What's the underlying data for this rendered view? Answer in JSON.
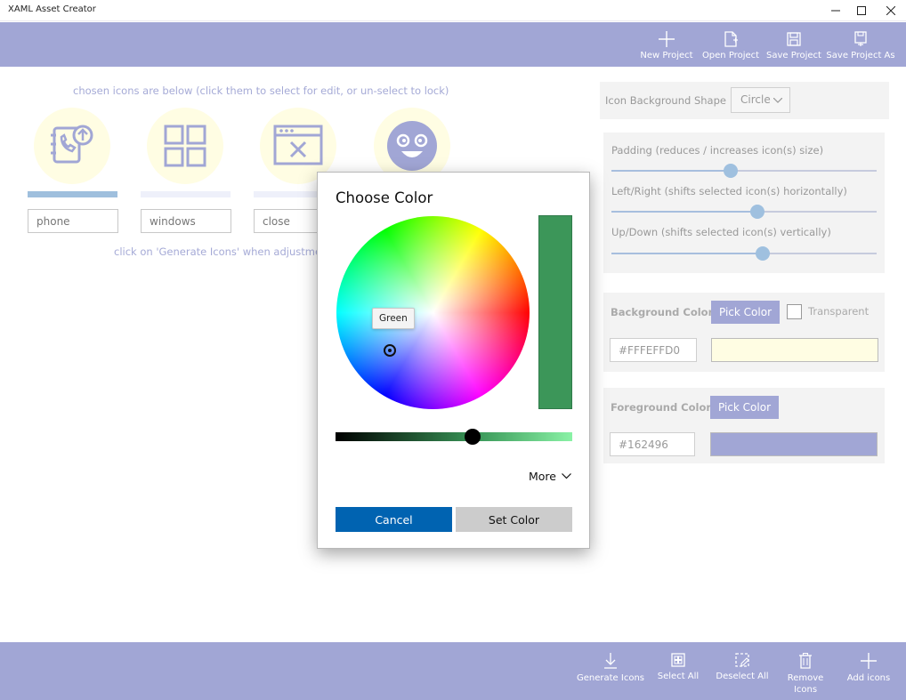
{
  "window": {
    "title": "XAML Asset Creator",
    "controls": [
      "minimize-icon",
      "maximize-icon",
      "close-icon"
    ]
  },
  "toolbar": {
    "items": [
      {
        "label": "New Project",
        "icon": "plus-icon"
      },
      {
        "label": "Open Project",
        "icon": "open-file-icon"
      },
      {
        "label": "Save Project",
        "icon": "save-icon"
      },
      {
        "label": "Save Project As",
        "icon": "save-as-icon"
      }
    ]
  },
  "main": {
    "hint": "chosen icons are below (click them to select for edit, or un-select to lock)",
    "generate_hint": "click on 'Generate Icons' when adjustments",
    "icons": [
      {
        "name": "phone",
        "icon": "phone-icon",
        "selected_for_edit": true
      },
      {
        "name": "windows",
        "icon": "windows-icon",
        "selected_for_edit": false
      },
      {
        "name": "close",
        "icon": "close-window-icon",
        "selected_for_edit": false
      },
      {
        "name": "",
        "icon": "smiley-face-icon",
        "selected_for_edit": false
      }
    ]
  },
  "settings": {
    "shape_label": "Icon Background Shape",
    "shape_value": "Circle",
    "padding_label": "Padding (reduces / increases icon(s) size)",
    "padding_value": 0.45,
    "leftright_label": "Left/Right (shifts selected icon(s) horizontally)",
    "leftright_value": 0.55,
    "updown_label": "Up/Down (shifts selected icon(s) vertically)",
    "updown_value": 0.57,
    "background": {
      "label": "Background Color",
      "pick_label": "Pick Color",
      "transparent_label": "Transparent",
      "transparent_checked": false,
      "hex": "#FFFEFFD0",
      "swatch_color": "#fffde3"
    },
    "foreground": {
      "label": "Foreground Color",
      "pick_label": "Pick Color",
      "hex": "#162496",
      "swatch_color": "#a1a6d5"
    }
  },
  "bottombar": {
    "items": [
      {
        "label": "Generate Icons",
        "icon": "download-icon"
      },
      {
        "label": "Select All",
        "icon": "select-all-icon"
      },
      {
        "label": "Deselect All",
        "icon": "deselect-all-icon"
      },
      {
        "label": "Remove Icons",
        "icon": "trash-icon"
      },
      {
        "label": "Add icons",
        "icon": "plus-icon"
      }
    ]
  },
  "dialog": {
    "title": "Choose Color",
    "tooltip": "Green",
    "preview_color": "#3c9659",
    "value_level": 0.58,
    "more_label": "More",
    "cancel_label": "Cancel",
    "set_label": "Set Color"
  },
  "colors": {
    "accent": "#a1a6d5",
    "primary_button": "#0063b1"
  }
}
